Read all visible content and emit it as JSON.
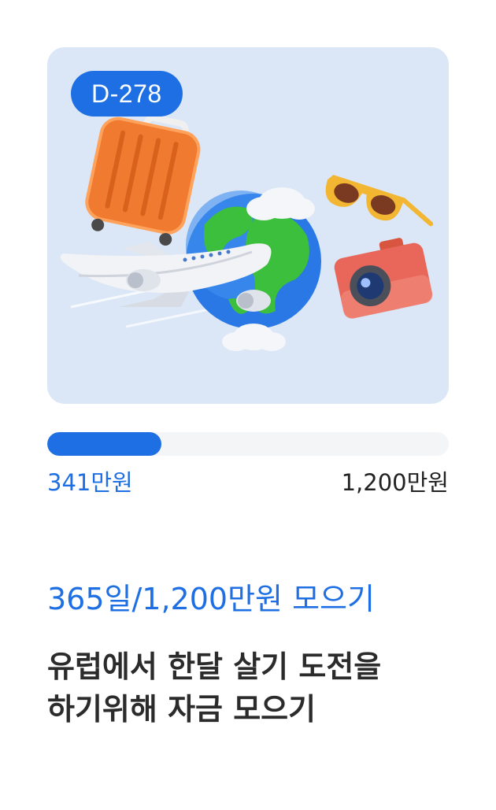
{
  "hero": {
    "badge": "D-278"
  },
  "progress": {
    "fraction": 0.284,
    "current_label": "341만원",
    "goal_label": "1,200만원"
  },
  "subtitle": "365일/1,200만원 모으기",
  "title_line1": "유럽에서 한달 살기 도전을",
  "title_line2": "하기위해 자금 모으기",
  "colors": {
    "accent": "#1e6fe3",
    "card_bg": "#dbe7f6",
    "track": "#f4f5f7"
  }
}
